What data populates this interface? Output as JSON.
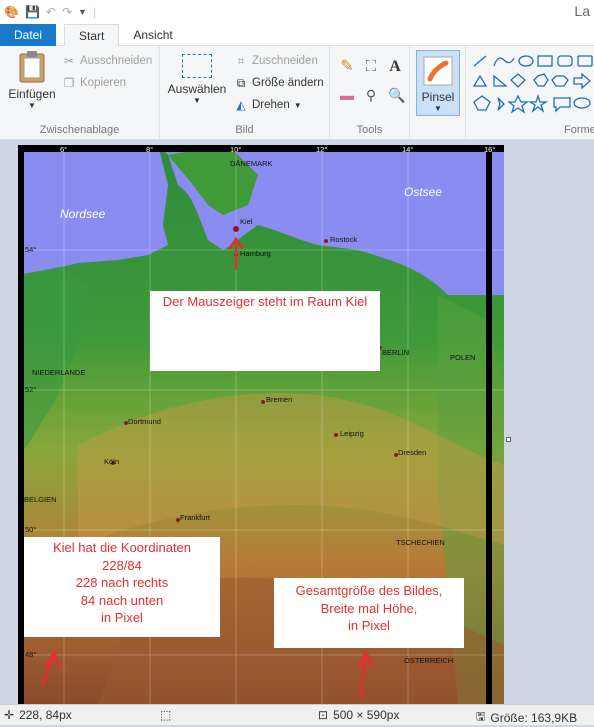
{
  "window": {
    "title": "La"
  },
  "tabs": {
    "file": "Datei",
    "start": "Start",
    "view": "Ansicht"
  },
  "clipboard": {
    "paste": "Einfügen",
    "cut": "Ausschneiden",
    "copy": "Kopieren",
    "label": "Zwischenablage"
  },
  "image_group": {
    "select": "Auswählen",
    "crop": "Zuschneiden",
    "resize": "Größe ändern",
    "rotate": "Drehen",
    "label": "Bild"
  },
  "tools": {
    "label": "Tools",
    "text_glyph": "A"
  },
  "brush": {
    "label": "Pinsel"
  },
  "shapes": {
    "label": "Forme"
  },
  "map": {
    "seas": [
      "Nordsee",
      "Ostsee"
    ],
    "countries": [
      "DÄNEMARK",
      "NIEDERLANDE",
      "POLEN",
      "BELGIEN",
      "TSCHECHIEN",
      "ÖSTERREICH"
    ],
    "cities": [
      "Kiel",
      "Rostock",
      "Hamburg",
      "BERLIN",
      "Dortmund",
      "Köln",
      "Leipzig",
      "Dresden",
      "Frankfurt",
      "Bremen"
    ],
    "lon_ticks": [
      "6°",
      "8°",
      "10°",
      "12°",
      "14°",
      "16°"
    ],
    "lat_ticks": [
      "54°",
      "52°",
      "50°",
      "48°"
    ]
  },
  "annotations": {
    "mouse": "Der Mauszeiger steht im Raum Kiel",
    "coords": [
      "Kiel hat die Koordinaten",
      "228/84",
      "228 nach rechts",
      "84 nach unten",
      "in Pixel"
    ],
    "size": [
      "Gesamtgröße des Bildes,",
      "Breite mal Höhe,",
      "in Pixel"
    ]
  },
  "status": {
    "cursor": "228, 84px",
    "dimensions": "500 × 590px",
    "filesize": "Größe: 163,9KB"
  },
  "colors": {
    "accent": "#1979ca",
    "annotation": "#e03030",
    "sea": "#8a8cf0",
    "lowland": "#2e8b3a"
  }
}
